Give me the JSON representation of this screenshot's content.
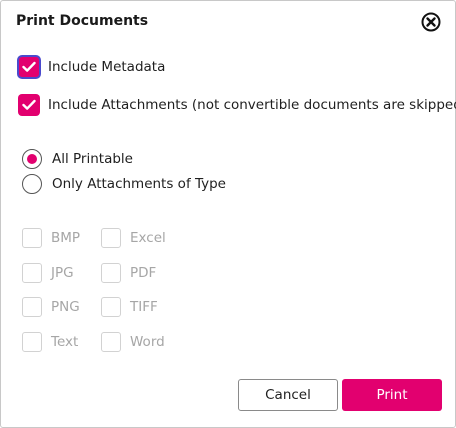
{
  "dialog": {
    "title": "Print Documents",
    "close_icon": "close-circle-icon"
  },
  "options": {
    "include_metadata": {
      "label": "Include Metadata",
      "checked": true
    },
    "include_attachments": {
      "label": "Include Attachments (not convertible documents are skipped)",
      "checked": true
    }
  },
  "scope": {
    "all_printable": {
      "label": "All Printable",
      "selected": true
    },
    "only_attachments": {
      "label": "Only Attachments of Type",
      "selected": false
    }
  },
  "types": [
    {
      "label": "BMP",
      "checked": false
    },
    {
      "label": "Excel",
      "checked": false
    },
    {
      "label": "JPG",
      "checked": false
    },
    {
      "label": "PDF",
      "checked": false
    },
    {
      "label": "PNG",
      "checked": false
    },
    {
      "label": "TIFF",
      "checked": false
    },
    {
      "label": "Text",
      "checked": false
    },
    {
      "label": "Word",
      "checked": false
    }
  ],
  "buttons": {
    "cancel_label": "Cancel",
    "print_label": "Print"
  },
  "colors": {
    "accent": "#e2006f",
    "focus_ring": "#4a4acd",
    "disabled_text": "#a6a6a6"
  }
}
